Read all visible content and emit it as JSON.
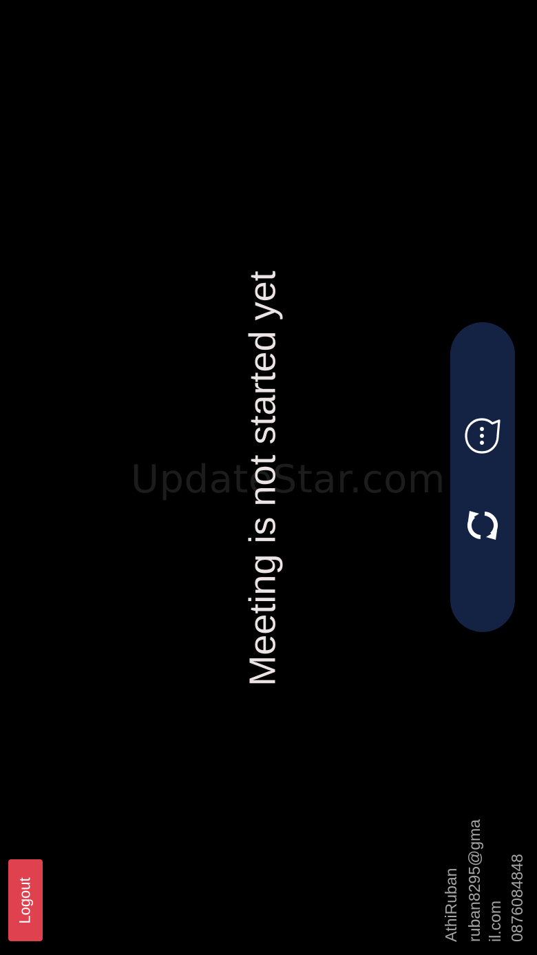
{
  "watermark": {
    "text": "UpdateStar.com"
  },
  "meeting": {
    "status_message": "Meeting is not started yet"
  },
  "controls": {
    "chat_icon": "chat-bubble-icon",
    "refresh_icon": "refresh-icon",
    "pill_color": "#142344"
  },
  "logout": {
    "label": "Logout",
    "color": "#e0414f"
  },
  "user": {
    "name": "AthiRuban",
    "email_line1": "ruban8295@gma",
    "email_line2": "il.com",
    "phone": "0876084848"
  }
}
